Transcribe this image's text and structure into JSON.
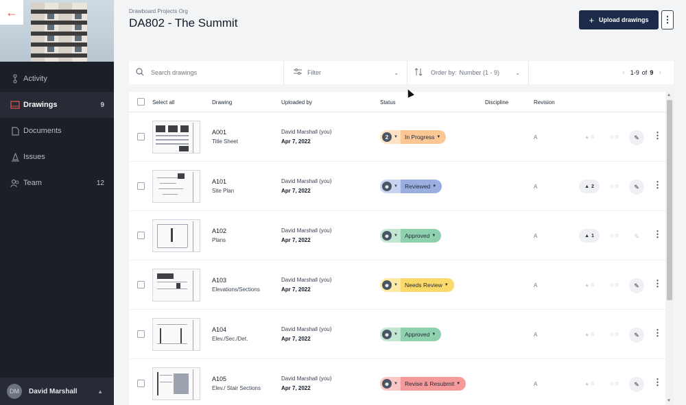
{
  "sidebar": {
    "back_icon": "back-arrow-icon",
    "nav": [
      {
        "label": "Activity",
        "icon": "activity-icon",
        "count": ""
      },
      {
        "label": "Drawings",
        "icon": "drawings-icon",
        "count": "9"
      },
      {
        "label": "Documents",
        "icon": "documents-icon",
        "count": ""
      },
      {
        "label": "Issues",
        "icon": "issues-icon",
        "count": ""
      },
      {
        "label": "Team",
        "icon": "team-icon",
        "count": "12"
      }
    ],
    "user": {
      "initials": "DM",
      "name": "David Marshall"
    }
  },
  "header": {
    "org": "Drawboard Projects Org",
    "title": "DA802 - The Summit",
    "upload_label": "Upload drawings",
    "upload_icon": "plus-icon"
  },
  "toolbar": {
    "search_placeholder": "Search drawings",
    "filter_label": "Filter",
    "order_label": "Order by:",
    "order_value": "Number (1 - 9)",
    "pager": {
      "range": "1-9",
      "of": "of",
      "total": "9"
    }
  },
  "table": {
    "headers": {
      "select_all": "Select all",
      "drawing": "Drawing",
      "uploaded_by": "Uploaded by",
      "status": "Status",
      "discipline": "Discipline",
      "revision": "Revision"
    },
    "rows": [
      {
        "number": "A001",
        "name": "Title Sheet",
        "uploaded_by": "David Marshall (you)",
        "date": "Apr 7, 2022",
        "status": "In Progress",
        "avatar_text": "2",
        "revision": "A",
        "issues": "0",
        "tags": "0",
        "issues_active": false,
        "edit_active": true
      },
      {
        "number": "A101",
        "name": "Site Plan",
        "uploaded_by": "David Marshall (you)",
        "date": "Apr 7, 2022",
        "status": "Reviewed",
        "avatar_text": "",
        "revision": "A",
        "issues": "2",
        "tags": "0",
        "issues_active": true,
        "edit_active": true
      },
      {
        "number": "A102",
        "name": "Plans",
        "uploaded_by": "David Marshall (you)",
        "date": "Apr 7, 2022",
        "status": "Approved",
        "avatar_text": "",
        "revision": "A",
        "issues": "1",
        "tags": "0",
        "issues_active": true,
        "edit_active": false
      },
      {
        "number": "A103",
        "name": "Elevations/Sections",
        "uploaded_by": "David Marshall (you)",
        "date": "Apr 7, 2022",
        "status": "Needs Review",
        "avatar_text": "",
        "revision": "A",
        "issues": "0",
        "tags": "0",
        "issues_active": false,
        "edit_active": true
      },
      {
        "number": "A104",
        "name": "Elev./Sec./Det.",
        "uploaded_by": "David Marshall (you)",
        "date": "Apr 7, 2022",
        "status": "Approved",
        "avatar_text": "",
        "revision": "A",
        "issues": "0",
        "tags": "0",
        "issues_active": false,
        "edit_active": true
      },
      {
        "number": "A105",
        "name": "Elev./ Stair Sections",
        "uploaded_by": "David Marshall (you)",
        "date": "Apr 7, 2022",
        "status": "Revise & Resubmit",
        "avatar_text": "",
        "revision": "A",
        "issues": "0",
        "tags": "0",
        "issues_active": false,
        "edit_active": true
      }
    ]
  },
  "status_colors": {
    "In Progress": {
      "left": "#fde2c4",
      "label": "#fbc795"
    },
    "Reviewed": {
      "left": "#c9d3ef",
      "label": "#9aaee0"
    },
    "Approved": {
      "left": "#c3e6d3",
      "label": "#8fd1ae"
    },
    "Needs Review": {
      "left": "#fdeaa6",
      "label": "#fbd96a"
    },
    "Revise & Resubmit": {
      "left": "#fbc6c6",
      "label": "#f59a9a"
    }
  }
}
